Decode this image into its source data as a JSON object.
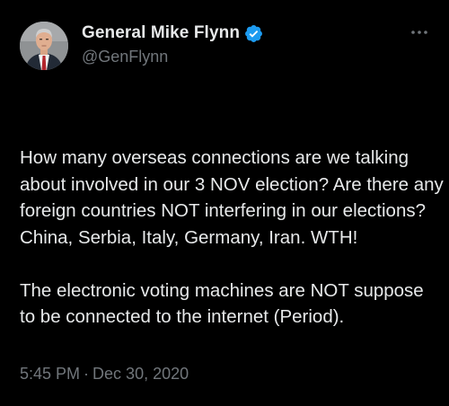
{
  "tweet": {
    "display_name": "General Mike Flynn",
    "handle": "@GenFlynn",
    "verified_icon": "verified-badge-icon",
    "more_icon": "more-options-icon",
    "paragraphs": [
      "How many overseas connections are we talking about involved in our 3 NOV election? Are there any foreign countries NOT interfering in our elections? China, Serbia, Italy, Germany, Iran. WTH!",
      "The electronic voting machines are NOT suppose to be connected to the internet (Period)."
    ],
    "time": "5:45 PM",
    "separator": "·",
    "date": "Dec 30, 2020"
  },
  "colors": {
    "background": "#000000",
    "text_primary": "#e7e9ea",
    "text_secondary": "#71767b",
    "verified_badge": "#1d9bf0"
  }
}
